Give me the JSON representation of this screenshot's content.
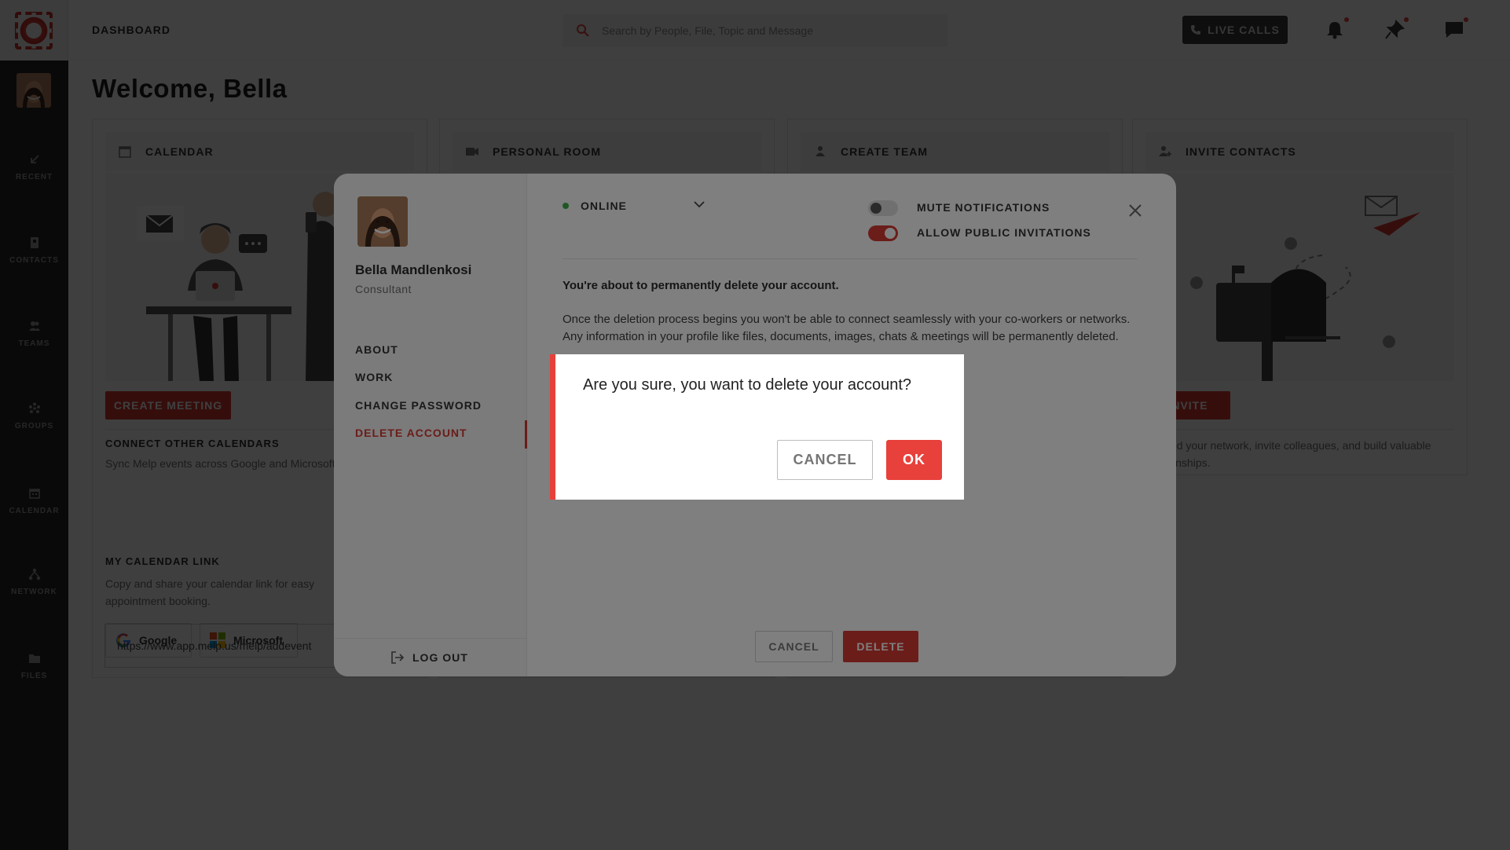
{
  "app": {
    "logo_icon": "melp-logo",
    "accent_color": "#d63a33"
  },
  "header": {
    "breadcrumb": "DASHBOARD",
    "search_placeholder": "Search by People, File, Topic and Message",
    "live_calls_label": "LIVE CALLS",
    "icons": [
      "bell-icon",
      "pin-icon",
      "chat-icon"
    ]
  },
  "sidebar": {
    "items": [
      {
        "label": "RECENT",
        "icon": "recent-arrow-icon"
      },
      {
        "label": "CONTACTS",
        "icon": "contacts-icon"
      },
      {
        "label": "TEAMS",
        "icon": "teams-icon"
      },
      {
        "label": "GROUPS",
        "icon": "groups-icon"
      },
      {
        "label": "CALENDAR",
        "icon": "calendar-icon"
      },
      {
        "label": "NETWORK",
        "icon": "network-icon"
      },
      {
        "label": "FILES",
        "icon": "folder-icon"
      }
    ]
  },
  "main": {
    "welcome": "Welcome, Bella",
    "cards": [
      {
        "title": "CALENDAR",
        "icon": "calendar-icon"
      },
      {
        "title": "PERSONAL ROOM",
        "icon": "video-icon"
      },
      {
        "title": "CREATE TEAM",
        "icon": "team-icon"
      },
      {
        "title": "INVITE CONTACTS",
        "icon": "add-user-icon"
      }
    ],
    "calendar": {
      "create_meeting": "CREATE MEETING",
      "connect_title": "CONNECT OTHER CALENDARS",
      "connect_text": "Sync Melp events across Google and Microsoft Calendars.",
      "google": "Google",
      "microsoft": "Microsoft",
      "link_title": "MY CALENDAR LINK",
      "link_text": "Copy and share your calendar link for easy appointment booking.",
      "link_value": "https://www.app.melp.us/melp/addevent"
    },
    "invite": {
      "button": "INVITE",
      "text": "Expand your network, invite colleagues, and build valuable relationships."
    }
  },
  "profile_modal": {
    "name": "Bella Mandlenkosi",
    "role": "Consultant",
    "nav": [
      "ABOUT",
      "WORK",
      "CHANGE PASSWORD",
      "DELETE ACCOUNT"
    ],
    "active_nav": "DELETE ACCOUNT",
    "logout": "LOG OUT",
    "status": "ONLINE",
    "mute_notifications": {
      "label": "MUTE NOTIFICATIONS",
      "on": false
    },
    "allow_invitations": {
      "label": "ALLOW PUBLIC INVITATIONS",
      "on": true
    },
    "warning_title": "You're about to permanently delete your account.",
    "warning_text": "Once the deletion process begins you won't be able to connect seamlessly with your co-workers or networks. Any information in your profile like files, documents, images, chats & meetings will be permanently deleted.",
    "cancel": "CANCEL",
    "delete": "DELETE"
  },
  "confirm_dialog": {
    "message": "Are you sure, you want to delete your account?",
    "cancel": "CANCEL",
    "ok": "OK"
  }
}
